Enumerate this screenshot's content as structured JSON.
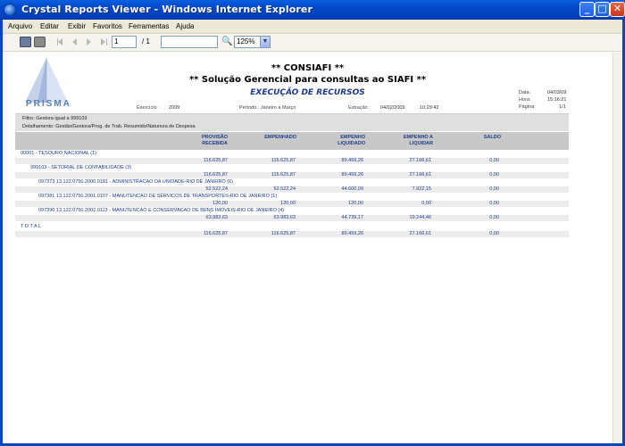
{
  "window": {
    "title": "Crystal Reports Viewer - Windows Internet Explorer",
    "min": "_",
    "max": "□",
    "close": "✕"
  },
  "menu": [
    "Arquivo",
    "Editar",
    "Exibir",
    "Favoritos",
    "Ferramentas",
    "Ajuda"
  ],
  "toolbar": {
    "page_value": "1",
    "page_total": "/ 1",
    "search_value": "",
    "zoom_value": "125%",
    "zoom_arrow": "▼",
    "search_glyph": "🔍"
  },
  "report": {
    "logo_text": "PRISMA",
    "title1": "** CONSIAFI **",
    "title2": "** Solução Gerencial para consultas ao SIAFI **",
    "title3": "EXECUÇÃO DE RECURSOS",
    "exercicio_label": "Exercício :",
    "exercicio_value": "2009",
    "periodo_label": "Período : Janeiro a Março",
    "extracao_label": "Extração :",
    "extracao_date": "04/02/2009",
    "extracao_time": "10:29:42",
    "data_label": "Data:",
    "data_value": "04/03/09",
    "hora_label": "Hora:",
    "hora_value": "15:16:21",
    "pagina_label": "Página:",
    "pagina_value": "1/1",
    "filtro": "Filtro: Gestora igual a 999103",
    "detalhamento": "Detalhamento: Gestão/Gestora/Prog. de Trab. Resumido/Natureza de Despesa",
    "headers": {
      "provisao": [
        "PROVISÃO",
        "RECEBIDA"
      ],
      "empenhado": [
        "EMPENHADO"
      ],
      "liquidado": [
        "EMPENHO",
        "LIQUIDADO"
      ],
      "a_liquidar": [
        "EMPENHO A",
        "LIQUIDAR"
      ],
      "saldo": [
        "SALDO"
      ]
    },
    "rows": [
      {
        "label": "00001 - TESOURO NACIONAL (1)",
        "values": [
          "116.625,87",
          "116.625,87",
          "89.459,26",
          "27.166,61",
          "0,00"
        ]
      },
      {
        "label": "999103 - SETORIAL DE CONTABILIDADE (3)",
        "values": [
          "116.625,87",
          "116.625,87",
          "89.459,26",
          "27.166,61",
          "0,00"
        ]
      },
      {
        "label": "097373 13.122.0750.2000.0181 - ADMINISTRACAO DA UNIDADE-RIO DE JANEIRO (6)",
        "values": [
          "52.522,24",
          "52.522,24",
          "44.600,09",
          "7.922,15",
          "0,00"
        ]
      },
      {
        "label": "097381 13.122.0750.2001.0107 - MANUTENCAO DE SERVICOS DE TRANSPORTES-RIO DE JANEIRO (1)",
        "values": [
          "120,00",
          "120,00",
          "120,00",
          "0,00",
          "0,00"
        ]
      },
      {
        "label": "097390 13.122.0750.2002.0113 - MANUTENCAO E CONSERVACAO DE BENS IMOVEIS-RIO DE JANEIRO (4)",
        "values": [
          "63.983,63",
          "63.983,63",
          "44.739,17",
          "19.244,46",
          "0,00"
        ]
      },
      {
        "label": "T O T A L",
        "values": [
          "116.625,87",
          "116.625,87",
          "89.459,26",
          "27.166,61",
          "0,00"
        ]
      }
    ]
  },
  "colors": {
    "titlebar": "#0347c9",
    "menubar": "#ece9d8",
    "report_text_blue": "#1e3a8a",
    "band_gray": "#c8c8c8"
  }
}
